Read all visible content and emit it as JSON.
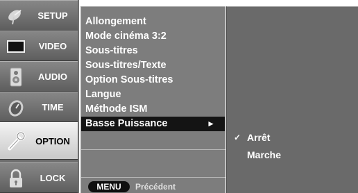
{
  "sidebar": {
    "items": [
      {
        "label": "SETUP",
        "icon": "satellite-dish-icon",
        "active": false
      },
      {
        "label": "VIDEO",
        "icon": "tv-screen-icon",
        "active": false
      },
      {
        "label": "AUDIO",
        "icon": "speaker-icon",
        "active": false
      },
      {
        "label": "TIME",
        "icon": "clock-icon",
        "active": false
      },
      {
        "label": "OPTION",
        "icon": "wrench-icon",
        "active": true
      },
      {
        "label": "LOCK",
        "icon": "padlock-icon",
        "active": false
      }
    ]
  },
  "menu": {
    "items": [
      {
        "label": "Allongement"
      },
      {
        "label": "Mode cinéma 3:2"
      },
      {
        "label": "Sous-titres"
      },
      {
        "label": "Sous-titres/Texte"
      },
      {
        "label": "Option Sous-titres"
      },
      {
        "label": "Langue"
      },
      {
        "label": "Méthode ISM"
      },
      {
        "label": "Basse Puissance",
        "selected": true,
        "arrow": "►"
      }
    ]
  },
  "footer": {
    "menu_key": "MENU",
    "back_label": "Précédent"
  },
  "submenu": {
    "items": [
      {
        "label": "Arrêt",
        "checked": true,
        "check": "✓"
      },
      {
        "label": "Marche",
        "checked": false,
        "check": ""
      }
    ]
  },
  "colors": {
    "sidebar_bg": "#6e6e6e",
    "menu_bg": "#7d7d7d",
    "submenu_bg": "#6a6a6a",
    "selected_bg": "#141414",
    "text": "#ffffff"
  }
}
